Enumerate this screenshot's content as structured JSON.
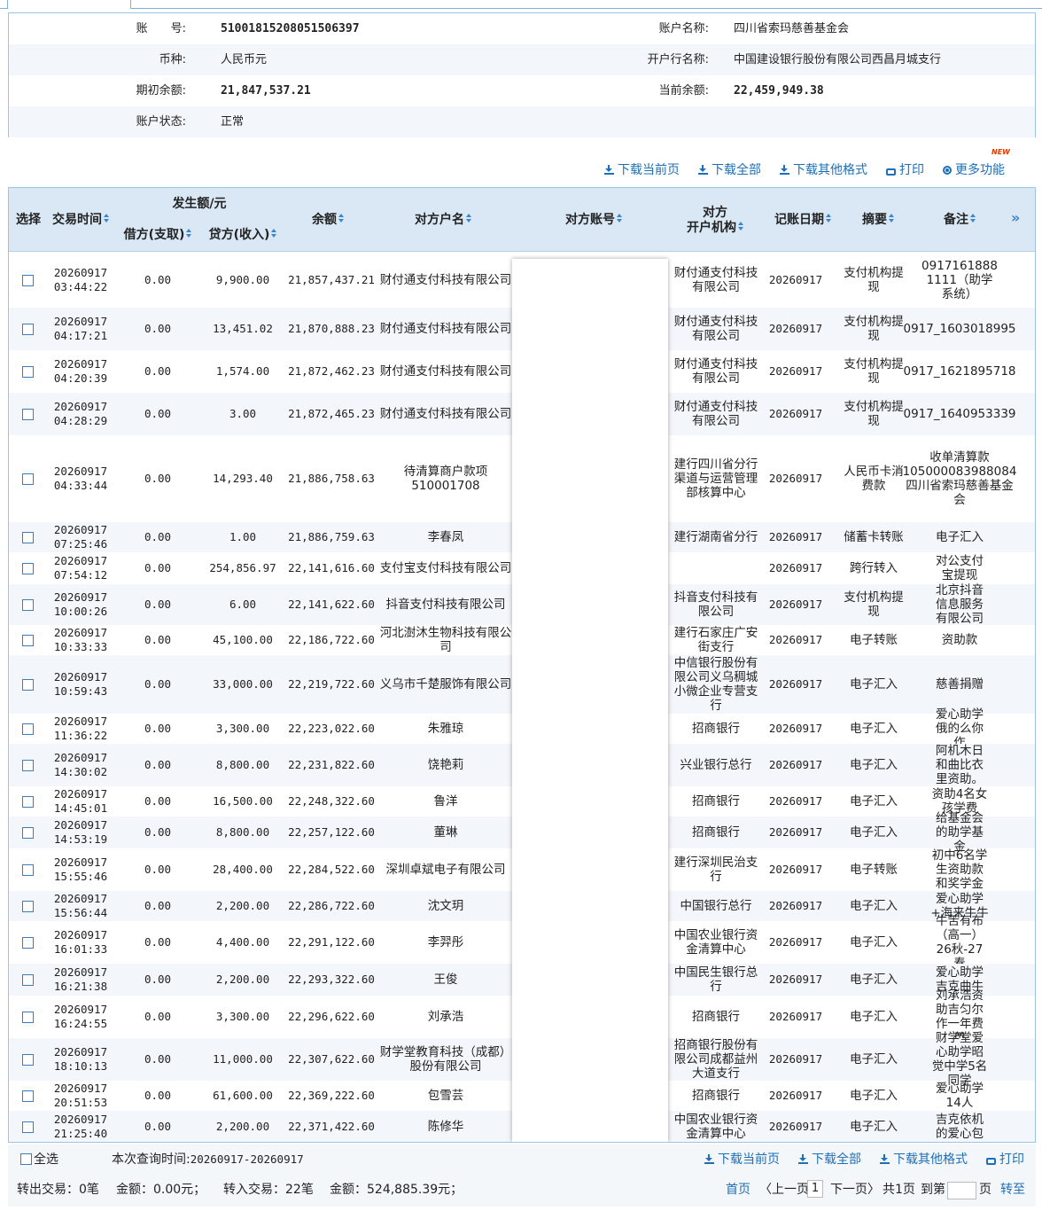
{
  "account": {
    "no_label": "账　　号:",
    "no_value": "510018152080515063​97",
    "name_label": "账户名称:",
    "name_value": "四川省索玛慈善基金会",
    "currency_label": "币种:",
    "currency_value": "人民币元",
    "bank_label": "开户行名称:",
    "bank_value": "中国建设银行股份有限公司西昌月城支行",
    "opening_label": "期初余额:",
    "opening_value": "21,847,537.21",
    "current_label": "当前余额:",
    "current_value": "22,459,949.38",
    "status_label": "账户状态:",
    "status_value": "正常"
  },
  "toolbar": {
    "new_badge": "NEW",
    "download_current": "下载当前页",
    "download_all": "下载全部",
    "download_other": "下载其他格式",
    "print": "打印",
    "more": "更多功能"
  },
  "table": {
    "headers": {
      "select": "选择",
      "time": "交易时间",
      "amount_group": "发生额/元",
      "debit": "借方(支取)",
      "credit": "贷方(收入)",
      "balance": "余额",
      "party_name": "对方户名",
      "party_account": "对方账号",
      "party_bank": "对方\n开户机构",
      "book_date": "记账日期",
      "summary": "摘要",
      "remark": "备注",
      "expand": "»"
    },
    "rows": [
      {
        "date": "20260917",
        "time": "03:44:22",
        "debit": "0.00",
        "credit": "9,900.00",
        "balance": "21,857,437.21",
        "name": "财付通支付科技有限公司",
        "bank": "财付通支付科技有限公司",
        "book": "20260917",
        "summary": "支付机构提现",
        "remark": "0917161888 1111（助学系统）"
      },
      {
        "date": "20260917",
        "time": "04:17:21",
        "debit": "0.00",
        "credit": "13,451.02",
        "balance": "21,870,888.23",
        "name": "财付通支付科技有限公司",
        "bank": "财付通支付科技有限公司",
        "book": "20260917",
        "summary": "支付机构提现",
        "remark": "0917_1603018995"
      },
      {
        "date": "20260917",
        "time": "04:20:39",
        "debit": "0.00",
        "credit": "1,574.00",
        "balance": "21,872,462.23",
        "name": "财付通支付科技有限公司",
        "bank": "财付通支付科技有限公司",
        "book": "20260917",
        "summary": "支付机构提现",
        "remark": "0917_1621895718"
      },
      {
        "date": "20260917",
        "time": "04:28:29",
        "debit": "0.00",
        "credit": "3.00",
        "balance": "21,872,465.23",
        "name": "财付通支付科技有限公司",
        "bank": "财付通支付科技有限公司",
        "book": "20260917",
        "summary": "支付机构提现",
        "remark": "0917_1640953339"
      },
      {
        "date": "20260917",
        "time": "04:33:44",
        "debit": "0.00",
        "credit": "14,293.40",
        "balance": "21,886,758.63",
        "name": "待清算商户款项510001708",
        "bank": "建行四川省分行渠道与运营管理部核算中心",
        "book": "20260917",
        "summary": "人民币卡消费款",
        "remark": "收单清算款105000083988084 四川省索玛慈善基金会"
      },
      {
        "date": "20260917",
        "time": "07:25:46",
        "debit": "0.00",
        "credit": "1.00",
        "balance": "21,886,759.63",
        "name": "李春凤",
        "bank": "建行湖南省分行",
        "book": "20260917",
        "summary": "储蓄卡转账",
        "remark": "电子汇入"
      },
      {
        "date": "20260917",
        "time": "07:54:12",
        "debit": "0.00",
        "credit": "254,856.97",
        "balance": "22,141,616.60",
        "name": "支付宝支付科技有限公司",
        "bank": "",
        "book": "20260917",
        "summary": "跨行转入",
        "remark": "对公支付宝提现"
      },
      {
        "date": "20260917",
        "time": "10:00:26",
        "debit": "0.00",
        "credit": "6.00",
        "balance": "22,141,622.60",
        "name": "抖音支付科技有限公司",
        "bank": "抖音支付科技有限公司",
        "book": "20260917",
        "summary": "支付机构提现",
        "remark": "北京抖音信息服务有限公司"
      },
      {
        "date": "20260917",
        "time": "10:33:33",
        "debit": "0.00",
        "credit": "45,100.00",
        "balance": "22,186,722.60",
        "name": "河北澍沐生物科技有限公司",
        "bank": "建行石家庄广安街支行",
        "book": "20260917",
        "summary": "电子转账",
        "remark": "资助款"
      },
      {
        "date": "20260917",
        "time": "10:59:43",
        "debit": "0.00",
        "credit": "33,000.00",
        "balance": "22,219,722.60",
        "name": "义乌市千楚服饰有限公司",
        "bank": "中信银行股份有限公司义乌稠城小微企业专营支行",
        "book": "20260917",
        "summary": "电子汇入",
        "remark": "慈善捐赠"
      },
      {
        "date": "20260917",
        "time": "11:36:22",
        "debit": "0.00",
        "credit": "3,300.00",
        "balance": "22,223,022.60",
        "name": "朱雅琼",
        "bank": "招商银行",
        "book": "20260917",
        "summary": "电子汇入",
        "remark": "爱心助学俄的么你作"
      },
      {
        "date": "20260917",
        "time": "14:30:02",
        "debit": "0.00",
        "credit": "8,800.00",
        "balance": "22,231,822.60",
        "name": "饶艳莉",
        "bank": "兴业银行总行",
        "book": "20260917",
        "summary": "电子汇入",
        "remark": "阿机木日和曲比衣里资助。"
      },
      {
        "date": "20260917",
        "time": "14:45:01",
        "debit": "0.00",
        "credit": "16,500.00",
        "balance": "22,248,322.60",
        "name": "鲁洋",
        "bank": "招商银行",
        "book": "20260917",
        "summary": "电子汇入",
        "remark": "资助4名女孩学费"
      },
      {
        "date": "20260917",
        "time": "14:53:19",
        "debit": "0.00",
        "credit": "8,800.00",
        "balance": "22,257,122.60",
        "name": "董琳",
        "bank": "招商银行",
        "book": "20260917",
        "summary": "电子汇入",
        "remark": "给基金会的助学基金"
      },
      {
        "date": "20260917",
        "time": "15:55:46",
        "debit": "0.00",
        "credit": "28,400.00",
        "balance": "22,284,522.60",
        "name": "深圳卓斌电子有限公司",
        "bank": "建行深圳民治支行",
        "book": "20260917",
        "summary": "电子转账",
        "remark": "初中6名学生资助款和奖学金"
      },
      {
        "date": "20260917",
        "time": "15:56:44",
        "debit": "0.00",
        "credit": "2,200.00",
        "balance": "22,286,722.60",
        "name": "沈文玥",
        "bank": "中国银行总行",
        "book": "20260917",
        "summary": "电子汇入",
        "remark": "爱心助学+海来牛牛"
      },
      {
        "date": "20260917",
        "time": "16:01:33",
        "debit": "0.00",
        "credit": "4,400.00",
        "balance": "22,291,122.60",
        "name": "李羿彤",
        "bank": "中国农业银行资金清算中心",
        "book": "20260917",
        "summary": "电子汇入",
        "remark": "牛苦有布（高一）26秋-27春"
      },
      {
        "date": "20260917",
        "time": "16:21:38",
        "debit": "0.00",
        "credit": "2,200.00",
        "balance": "22,293,322.60",
        "name": "王俊",
        "bank": "中国民生银行总行",
        "book": "20260917",
        "summary": "电子汇入",
        "remark": "爱心助学吉克曲牛"
      },
      {
        "date": "20260917",
        "time": "16:24:55",
        "debit": "0.00",
        "credit": "3,300.00",
        "balance": "22,296,622.60",
        "name": "刘承浩",
        "bank": "招商银行",
        "book": "20260917",
        "summary": "电子汇入",
        "remark": "刘承浩资助吉匀尔作一年费用"
      },
      {
        "date": "20260917",
        "time": "18:10:13",
        "debit": "0.00",
        "credit": "11,000.00",
        "balance": "22,307,622.60",
        "name": "财学堂教育科技（成都）股份有限公司",
        "bank": "招商银行股份有限公司成都益州大道支行",
        "book": "20260917",
        "summary": "电子汇入",
        "remark": "财学堂爱心助学昭觉中学5名同学"
      },
      {
        "date": "20260917",
        "time": "20:51:53",
        "debit": "0.00",
        "credit": "61,600.00",
        "balance": "22,369,222.60",
        "name": "包雪芸",
        "bank": "招商银行",
        "book": "20260917",
        "summary": "电子汇入",
        "remark": "爱心助学14人"
      },
      {
        "date": "20260917",
        "time": "21:25:40",
        "debit": "0.00",
        "credit": "2,200.00",
        "balance": "22,371,422.60",
        "name": "陈修华",
        "bank": "中国农业银行资金清算中心",
        "book": "20260917",
        "summary": "电子汇入",
        "remark": "吉克依机的爱心包"
      }
    ]
  },
  "footer": {
    "select_all": "全选",
    "query_time_label": "本次查询时间:",
    "query_time_value": "20260917-20260917",
    "download_current": "下载当前页",
    "download_all": "下载全部",
    "download_other": "下载其他格式",
    "print": "打印",
    "summary_out": "转出交易：0笔",
    "summary_out_amount": "金额：0.00元；",
    "summary_in": "转入交易：22笔",
    "summary_in_amount": "金额：524,885.39元；",
    "first_page": "首页",
    "prev_page": "〈上一页",
    "current_page": "1",
    "next_page": "下一页〉",
    "total_pages": "共1页",
    "goto_label": "到第",
    "page_unit": "页",
    "goto_button": "转至"
  }
}
